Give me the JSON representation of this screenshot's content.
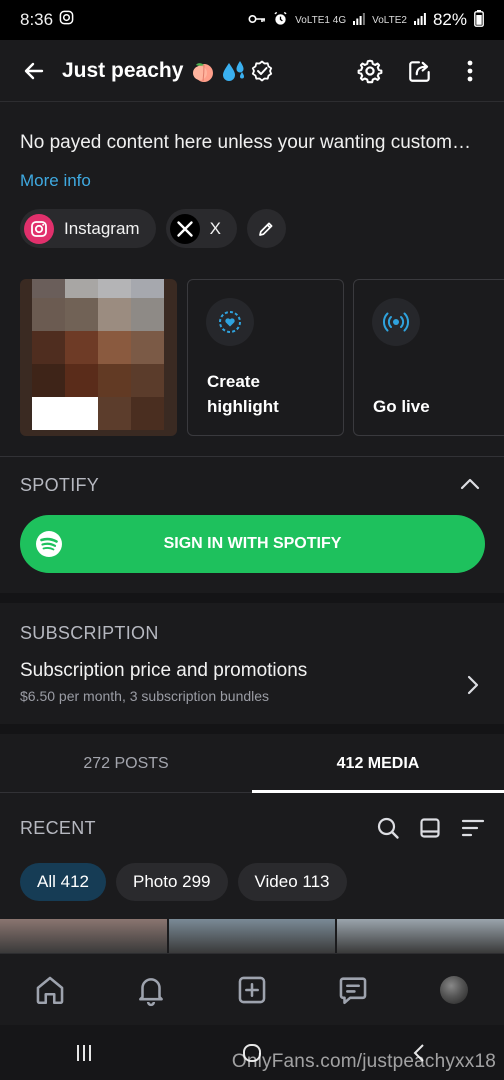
{
  "status_bar": {
    "time": "8:36",
    "network_1": "VoLTE1 4G",
    "network_2": "VoLTE2",
    "battery": "82%"
  },
  "header": {
    "title": "Just peachy",
    "emojis": [
      "peach",
      "sweat-droplets"
    ],
    "verified": true
  },
  "profile": {
    "bio": "No payed content here unless your wanting custom…",
    "more_info": "More info",
    "socials": [
      {
        "label": "Instagram"
      },
      {
        "label": "X"
      }
    ]
  },
  "highlights": {
    "create_label_1": "Create",
    "create_label_2": "highlight",
    "live_label": "Go live"
  },
  "spotify": {
    "section_title": "SPOTIFY",
    "button_label": "SIGN IN WITH SPOTIFY"
  },
  "subscription": {
    "section_title": "SUBSCRIPTION",
    "title": "Subscription price and promotions",
    "detail": "$6.50 per month, 3 subscription bundles"
  },
  "tabs": [
    {
      "label": "272 POSTS",
      "active": false
    },
    {
      "label": "412 MEDIA",
      "active": true
    }
  ],
  "recent": {
    "title": "RECENT"
  },
  "filters": [
    {
      "label": "All 412",
      "active": true
    },
    {
      "label": "Photo 299",
      "active": false
    },
    {
      "label": "Video 113",
      "active": false
    }
  ],
  "watermark": "OnlyFans.com/justpeachyxx18",
  "colors": {
    "accent": "#3fa9e0",
    "spotify": "#1ec15d",
    "background": "#1b1b1d",
    "active_pill": "#163c55"
  },
  "mosaic_colors": [
    "#6a5e5a",
    "#a8a6a4",
    "#b4b4b6",
    "#a6a8ae",
    "#6b5b51",
    "#716256",
    "#9b8c80",
    "#8e8a86",
    "#4f2d1f",
    "#6e3b26",
    "#8a5a3f",
    "#7b5a46",
    "#3e2418",
    "#5a2c1a",
    "#623a24",
    "#5b3c2b",
    "#ffffff",
    "#ffffff",
    "#5c3d2c",
    "#4a2e20"
  ],
  "thumb_colors": [
    "#8a7570",
    "#7a8a96",
    "#9aa4ac"
  ]
}
